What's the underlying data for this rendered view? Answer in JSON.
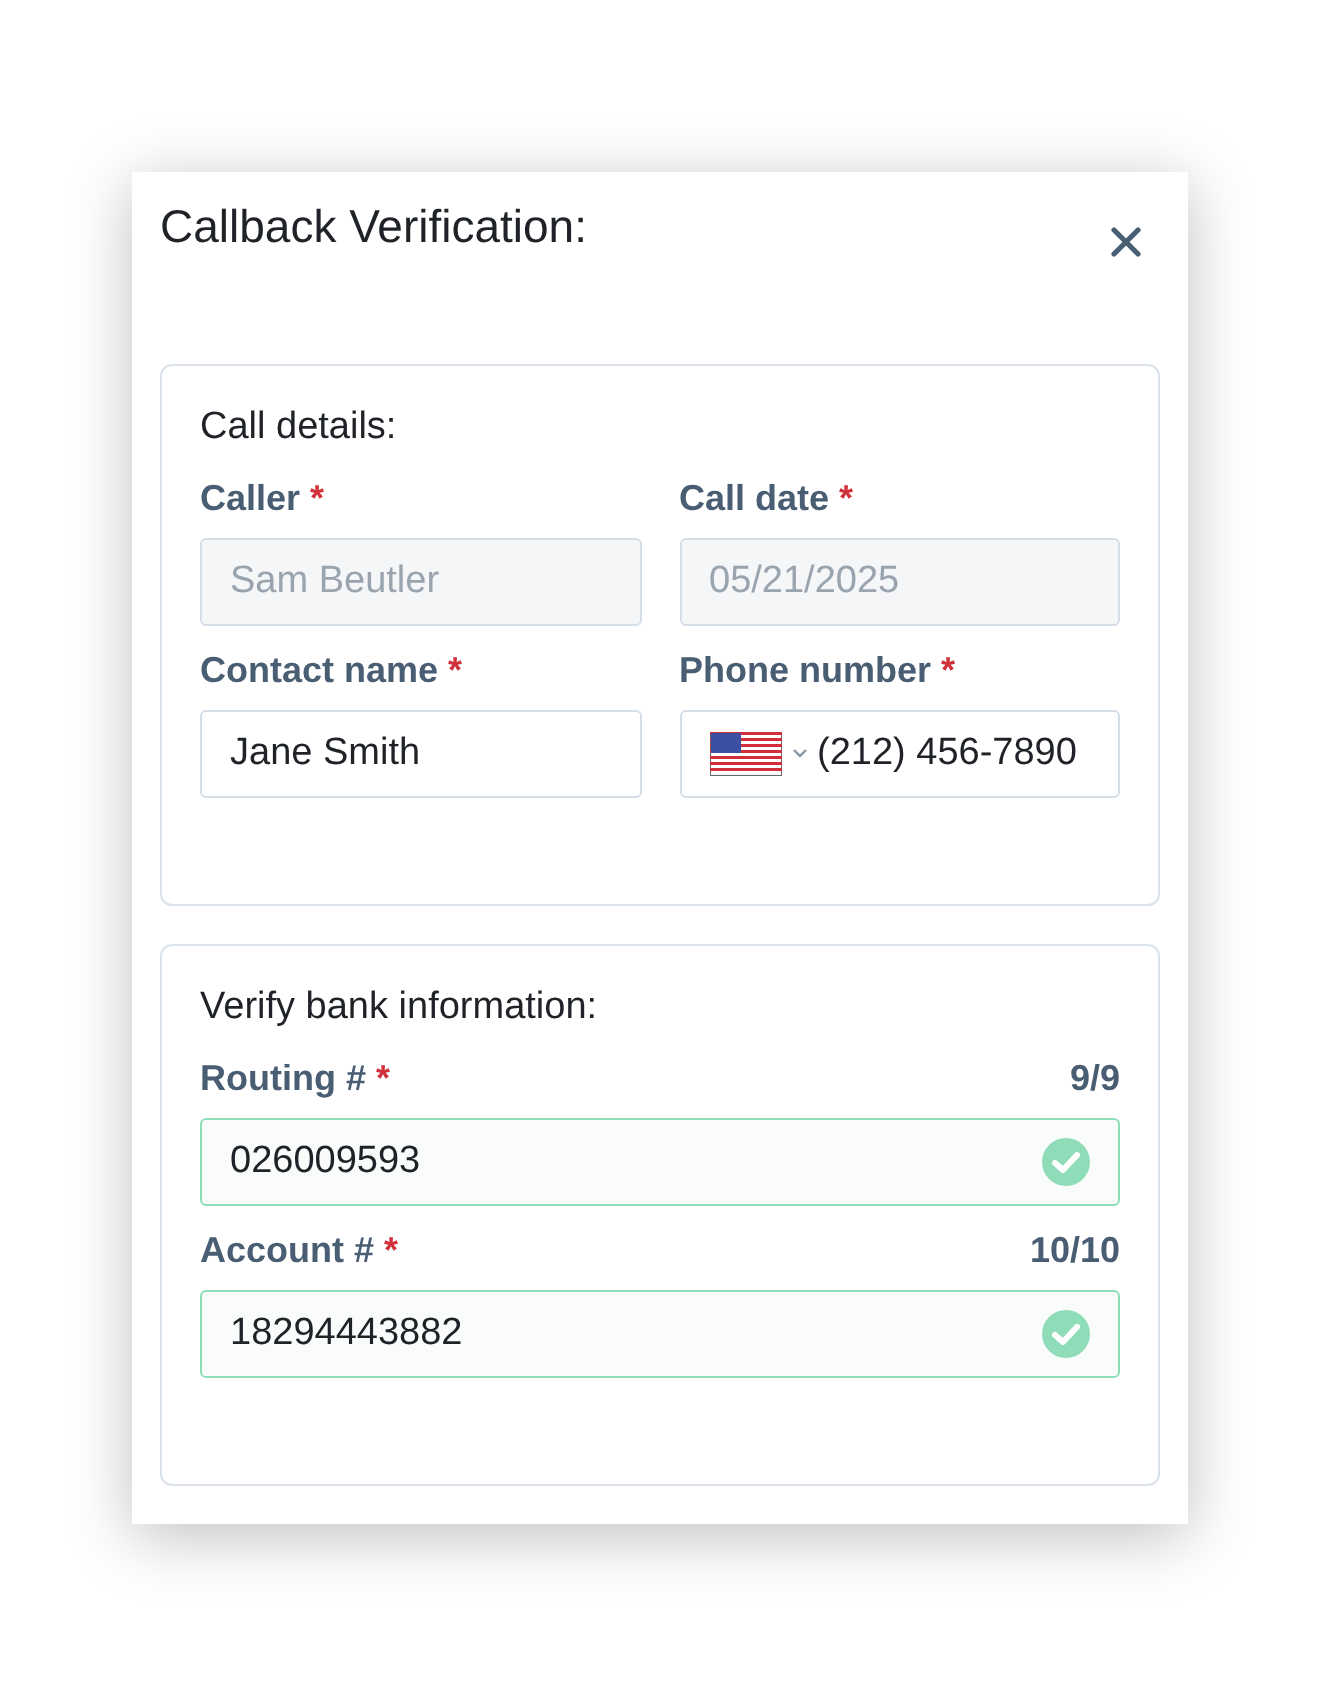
{
  "window": {
    "title": "Callback Verification:"
  },
  "sections": [
    {
      "title": "Call details:",
      "fields": [
        {
          "label": "Caller",
          "required_mark": "*",
          "kind": "text",
          "value": "Sam Beutler",
          "disabled": true
        },
        {
          "label": "Call date",
          "required_mark": "*",
          "kind": "text",
          "value": "05/21/2025",
          "disabled": true
        },
        {
          "label": "Contact name",
          "required_mark": "*",
          "kind": "text",
          "value": "Jane Smith",
          "disabled": false
        },
        {
          "label": "Phone number",
          "required_mark": "*",
          "kind": "phone",
          "value": "(212) 456-7890",
          "disabled": false
        }
      ]
    },
    {
      "title": "Verify bank information:",
      "fields": [
        {
          "label": "Routing #",
          "required_mark": "*",
          "kind": "text",
          "value": "026009593",
          "disabled": false,
          "counter": "9/9",
          "valid": true
        },
        {
          "label": "Account #",
          "required_mark": "*",
          "kind": "text",
          "value": "18294443882",
          "disabled": false,
          "counter": "10/10",
          "valid": true
        }
      ]
    }
  ]
}
